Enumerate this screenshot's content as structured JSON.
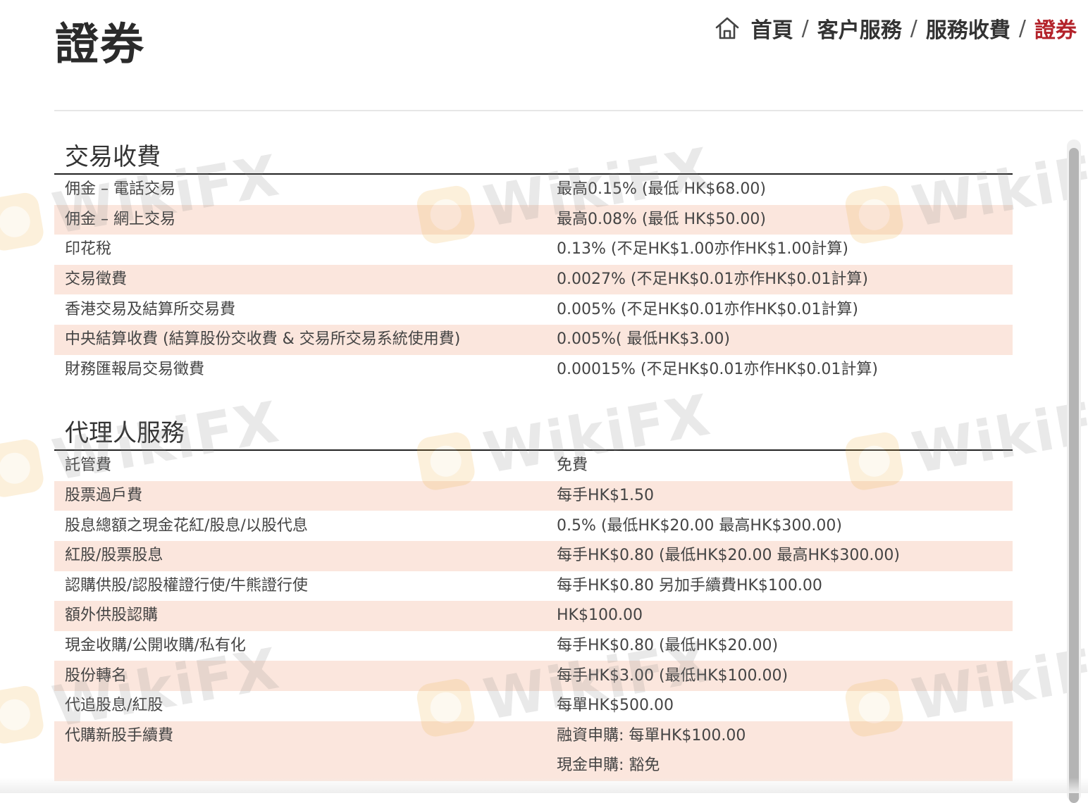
{
  "page": {
    "title": "證券"
  },
  "breadcrumb": {
    "items": [
      "首頁",
      "客户服務",
      "服務收費",
      "證券"
    ],
    "separator": "/",
    "active_color": "#b3222a"
  },
  "watermark": {
    "text": "WikiFX"
  },
  "sections": [
    {
      "title": "交易收費",
      "rows": [
        {
          "label": "佣金 – 電話交易",
          "value": "最高0.15% (最低  HK$68.00)"
        },
        {
          "label": "佣金 – 網上交易",
          "value": "最高0.08% (最低  HK$50.00)"
        },
        {
          "label": "印花稅",
          "value": "0.13% (不足HK$1.00亦作HK$1.00計算)"
        },
        {
          "label": "交易徵費",
          "value": "0.0027% (不足HK$0.01亦作HK$0.01計算)"
        },
        {
          "label": "香港交易及結算所交易費",
          "value": "0.005% (不足HK$0.01亦作HK$0.01計算)"
        },
        {
          "label": "中央結算收費 (結算股份交收費 & 交易所交易系統使用費)",
          "value": "0.005%( 最低HK$3.00)"
        },
        {
          "label": "財務匯報局交易徵費",
          "value": "0.00015% (不足HK$0.01亦作HK$0.01計算)"
        }
      ]
    },
    {
      "title": "代理人服務",
      "rows": [
        {
          "label": "託管費",
          "value": "免費"
        },
        {
          "label": "股票過戶費",
          "value": "每手HK$1.50"
        },
        {
          "label": "股息總額之現金花紅/股息/以股代息",
          "value": "0.5% (最低HK$20.00 最高HK$300.00)"
        },
        {
          "label": "紅股/股票股息",
          "value": "每手HK$0.80 (最低HK$20.00 最高HK$300.00)"
        },
        {
          "label": "認購供股/認股權證行使/牛熊證行使",
          "value": "每手HK$0.80 另加手續費HK$100.00"
        },
        {
          "label": "額外供股認購",
          "value": "HK$100.00"
        },
        {
          "label": "現金收購/公開收購/私有化",
          "value": "每手HK$0.80 (最低HK$20.00)"
        },
        {
          "label": "股份轉名",
          "value": "每手HK$3.00 (最低HK$100.00)"
        },
        {
          "label": "代追股息/紅股",
          "value": "每單HK$500.00"
        },
        {
          "label": "代購新股手續費",
          "value_lines": [
            "融資申購: 每單HK$100.00",
            "現金申購:  豁免"
          ]
        }
      ]
    }
  ]
}
